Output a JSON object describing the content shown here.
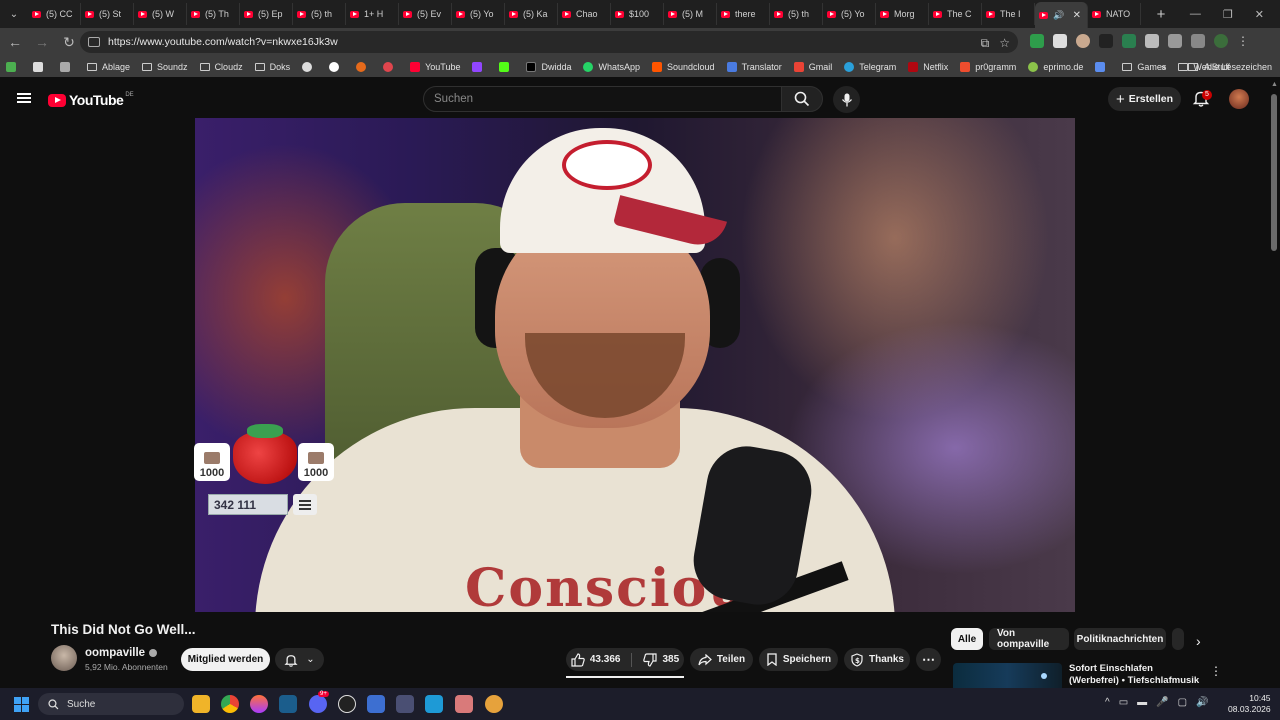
{
  "browser": {
    "tabs": [
      {
        "label": "(5) CC"
      },
      {
        "label": "(5) St"
      },
      {
        "label": "(5) W"
      },
      {
        "label": "(5) Th"
      },
      {
        "label": "(5) Ep"
      },
      {
        "label": "(5) th"
      },
      {
        "label": "1+ H"
      },
      {
        "label": "(5) Ev"
      },
      {
        "label": "(5) Yo"
      },
      {
        "label": "(5) Ka"
      },
      {
        "label": "Chao"
      },
      {
        "label": "$100"
      },
      {
        "label": "(5) M"
      },
      {
        "label": "there"
      },
      {
        "label": "(5) th"
      },
      {
        "label": "(5) Yo"
      },
      {
        "label": "Morg"
      },
      {
        "label": "The C"
      },
      {
        "label": "The I"
      },
      {
        "label": "",
        "active": true
      },
      {
        "label": "NATO"
      }
    ],
    "url": "https://www.youtube.com/watch?v=nkwxe16Jk3w",
    "bookmarks": [
      {
        "label": "Ablage",
        "icon": "folder-icon"
      },
      {
        "label": "Soundz",
        "icon": "folder-icon"
      },
      {
        "label": "Cloudz",
        "icon": "folder-icon"
      },
      {
        "label": "Doks",
        "icon": "folder-icon"
      },
      {
        "label": "YouTube",
        "icon": "youtube-icon"
      },
      {
        "label": "Dwidda",
        "icon": "x-icon"
      },
      {
        "label": "WhatsApp",
        "icon": "whatsapp-icon"
      },
      {
        "label": "Soundcloud",
        "icon": "soundcloud-icon"
      },
      {
        "label": "Translator",
        "icon": "translator-icon"
      },
      {
        "label": "Gmail",
        "icon": "gmail-icon"
      },
      {
        "label": "Telegram",
        "icon": "telegram-icon"
      },
      {
        "label": "Netflix",
        "icon": "netflix-icon"
      },
      {
        "label": "pr0gramm",
        "icon": "pr0gramm-icon"
      },
      {
        "label": "eprimo.de",
        "icon": "eprimo-icon"
      },
      {
        "label": "Games",
        "icon": "folder-icon"
      },
      {
        "label": "WebStuff",
        "icon": "folder-icon"
      }
    ],
    "all_bookmarks_label": "Alle Lesezeichen"
  },
  "youtube": {
    "logo_text": "YouTube",
    "region": "DE",
    "search_placeholder": "Suchen",
    "create_label": "Erstellen",
    "notification_count": "5",
    "video": {
      "overlay": {
        "left_count": "1000",
        "right_count": "1000",
        "score": "342 111"
      },
      "shirt_text": "Conscious"
    },
    "title": "This Did Not Go Well...",
    "channel": {
      "name": "oompaville",
      "subscribers": "5,92 Mio. Abonnenten"
    },
    "member_label": "Mitglied werden",
    "likes": "43.366",
    "dislikes": "385",
    "share_label": "Teilen",
    "save_label": "Speichern",
    "thanks_label": "Thanks",
    "chips": [
      {
        "label": "Alle",
        "active": true
      },
      {
        "label": "Von oompaville"
      },
      {
        "label": "Politiknachrichten"
      }
    ],
    "recommendation": {
      "title": "Sofort Einschlafen (Werbefrei) • Tiefschlafmusik • Beruhigt ..."
    }
  },
  "taskbar": {
    "search_label": "Suche",
    "time": "10:45",
    "date": "08.03.2026",
    "discord_badge": "9+"
  },
  "colors": {
    "youtube_red": "#ff0033",
    "background": "#0f0f0f",
    "button_bg": "#272727"
  }
}
